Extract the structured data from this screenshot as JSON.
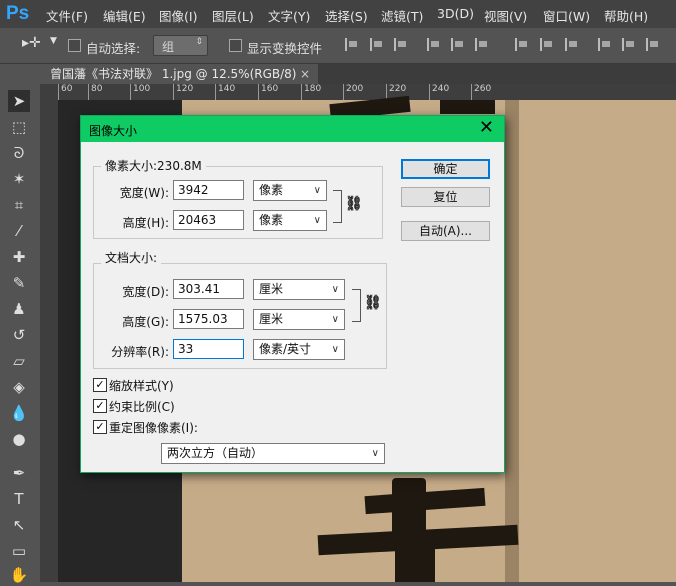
{
  "app": {
    "logo": "Ps"
  },
  "menu": [
    "文件(F)",
    "编辑(E)",
    "图像(I)",
    "图层(L)",
    "文字(Y)",
    "选择(S)",
    "滤镜(T)",
    "3D(D)",
    "视图(V)",
    "窗口(W)",
    "帮助(H)"
  ],
  "options": {
    "auto_select_label": "自动选择:",
    "auto_select_value": "组",
    "show_transform_label": "显示变换控件"
  },
  "document_tab": {
    "title": "曾国藩《书法对联》 1.jpg @ 12.5%(RGB/8)",
    "close": "×"
  },
  "ruler_ticks": [
    "60",
    "80",
    "100",
    "120",
    "140",
    "160",
    "180",
    "200",
    "220",
    "240",
    "260"
  ],
  "dialog": {
    "title": "图像大小",
    "close": "✕",
    "pixel_group_label": "像素大小:230.8M",
    "pixel_width_label": "宽度(W):",
    "pixel_width_value": "3942",
    "pixel_width_unit": "像素",
    "pixel_height_label": "高度(H):",
    "pixel_height_value": "20463",
    "pixel_height_unit": "像素",
    "doc_group_label": "文档大小:",
    "doc_width_label": "宽度(D):",
    "doc_width_value": "303.41",
    "doc_width_unit": "厘米",
    "doc_height_label": "高度(G):",
    "doc_height_value": "1575.03",
    "doc_height_unit": "厘米",
    "resolution_label": "分辨率(R):",
    "resolution_value": "33",
    "resolution_unit": "像素/英寸",
    "ok_label": "确定",
    "reset_label": "复位",
    "auto_label": "自动(A)...",
    "scale_styles_label": "缩放样式(Y)",
    "scale_styles_checked": true,
    "constrain_label": "约束比例(C)",
    "constrain_checked": true,
    "resample_label": "重定图像像素(I):",
    "resample_checked": true,
    "resample_method": "两次立方（自动）"
  }
}
